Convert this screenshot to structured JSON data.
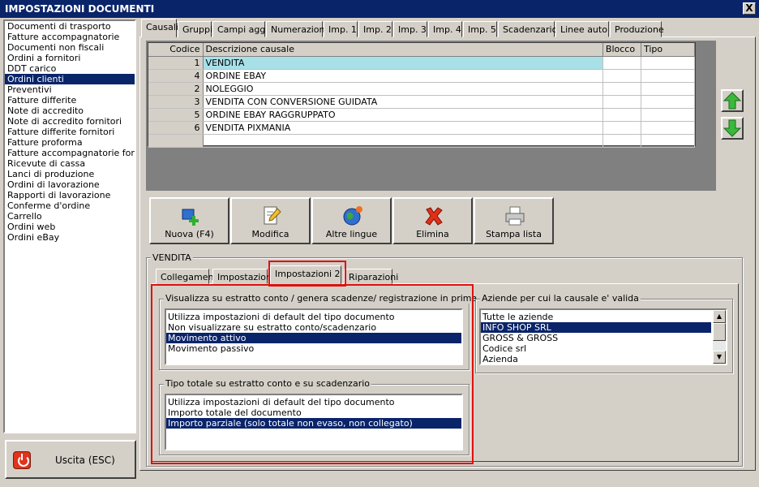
{
  "window": {
    "title": "IMPOSTAZIONI DOCUMENTI",
    "close_label": "X"
  },
  "doc_types": {
    "items": [
      "Documenti di trasporto",
      "Fatture accompagnatorie",
      "Documenti non fiscali",
      "Ordini a fornitori",
      "DDT carico",
      "Ordini clienti",
      "Preventivi",
      "Fatture differite",
      "Note di accredito",
      "Note di accredito fornitori",
      "Fatture differite fornitori",
      "Fatture proforma",
      "Fatture accompagnatorie fornito",
      "Ricevute di cassa",
      "Lanci di produzione",
      "Ordini di lavorazione",
      "Rapporti di lavorazione",
      "Conferme d'ordine",
      "Carrello",
      "Ordini web",
      "Ordini eBay"
    ],
    "selected": "Ordini clienti"
  },
  "exit": {
    "label": "Uscita (ESC)"
  },
  "main_tabs": [
    "Causali",
    "Gruppi",
    "Campi agg.",
    "Numerazioni",
    "Imp. 1",
    "Imp. 2",
    "Imp. 3",
    "Imp. 4",
    "Imp. 5",
    "Scadenzario",
    "Linee auto",
    "Produzione"
  ],
  "main_tab_active": "Causali",
  "grid": {
    "headers": [
      "Codice",
      "Descrizione causale",
      "Blocco",
      "Tipo"
    ],
    "rows": [
      {
        "code": "1",
        "desc": "VENDITA"
      },
      {
        "code": "4",
        "desc": "ORDINE EBAY"
      },
      {
        "code": "2",
        "desc": "NOLEGGIO"
      },
      {
        "code": "3",
        "desc": "VENDITA CON CONVERSIONE GUIDATA"
      },
      {
        "code": "5",
        "desc": "ORDINE EBAY RAGGRUPPATO"
      },
      {
        "code": "6",
        "desc": "VENDITA PIXMANIA"
      }
    ]
  },
  "actions": {
    "new": "Nuova (F4)",
    "edit": "Modifica",
    "languages": "Altre lingue",
    "delete": "Elimina",
    "print": "Stampa lista"
  },
  "detail": {
    "group_title": "VENDITA",
    "tabs": [
      "Collegamenti",
      "Impostazioni",
      "Impostazioni 2",
      "Riparazioni"
    ],
    "active_tab": "Impostazioni 2"
  },
  "statement": {
    "title": "Visualizza su estratto conto / genera scadenze/ registrazione  in prima nota",
    "options": [
      "Utilizza impostazioni di default del tipo documento",
      "Non visualizzare su estratto conto/scadenzario",
      "Movimento attivo",
      "Movimento passivo"
    ],
    "selected": "Movimento attivo"
  },
  "total_type": {
    "title": "Tipo totale su estratto conto e su scadenzario",
    "options": [
      "Utilizza impostazioni di default del tipo documento",
      "Importo totale del documento",
      "Importo parziale (solo totale non evaso, non collegato)"
    ],
    "selected": "Importo parziale (solo totale non evaso, non collegato)"
  },
  "companies": {
    "title": "Aziende per cui la causale e' valida",
    "items": [
      "Tutte le aziende",
      "INFO SHOP SRL",
      "GROSS & GROSS",
      "Codice srl",
      "Azienda"
    ],
    "selected": "INFO SHOP SRL"
  },
  "colors": {
    "title_bg": "#0a246a",
    "selection": "#0a246a",
    "highlight_row": "#a8e0e8",
    "red_outline": "#e01010"
  }
}
